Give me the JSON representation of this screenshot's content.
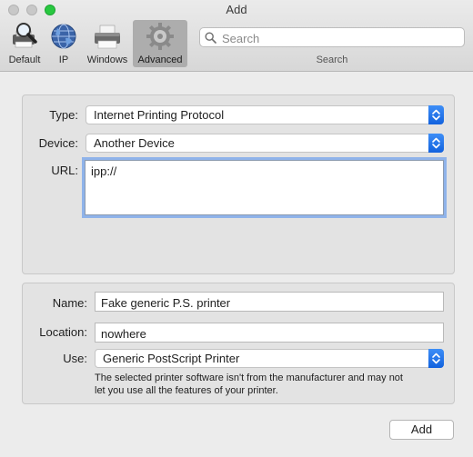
{
  "window": {
    "title": "Add"
  },
  "toolbar": {
    "items": [
      {
        "label": "Default",
        "icon": "printer-magnifier-icon"
      },
      {
        "label": "IP",
        "icon": "globe-icon"
      },
      {
        "label": "Windows",
        "icon": "printer-icon"
      },
      {
        "label": "Advanced",
        "icon": "gear-icon",
        "selected": true
      }
    ],
    "search": {
      "placeholder": "Search",
      "value": "",
      "caption": "Search"
    }
  },
  "connection": {
    "type_label": "Type:",
    "type_value": "Internet Printing Protocol",
    "device_label": "Device:",
    "device_value": "Another Device",
    "url_label": "URL:",
    "url_value": "ipp://"
  },
  "printer": {
    "name_label": "Name:",
    "name_value": "Fake generic P.S. printer",
    "location_label": "Location:",
    "location_value": "nowhere",
    "use_label": "Use:",
    "use_value": "Generic PostScript Printer",
    "note_line1": "The selected printer software isn't from the manufacturer and may not",
    "note_line2": "let you use all the features of your printer."
  },
  "actions": {
    "add_label": "Add"
  },
  "colors": {
    "accent": "#1a6fe8",
    "focus_ring": "#8fb3ea",
    "zoom": "#28c840"
  }
}
